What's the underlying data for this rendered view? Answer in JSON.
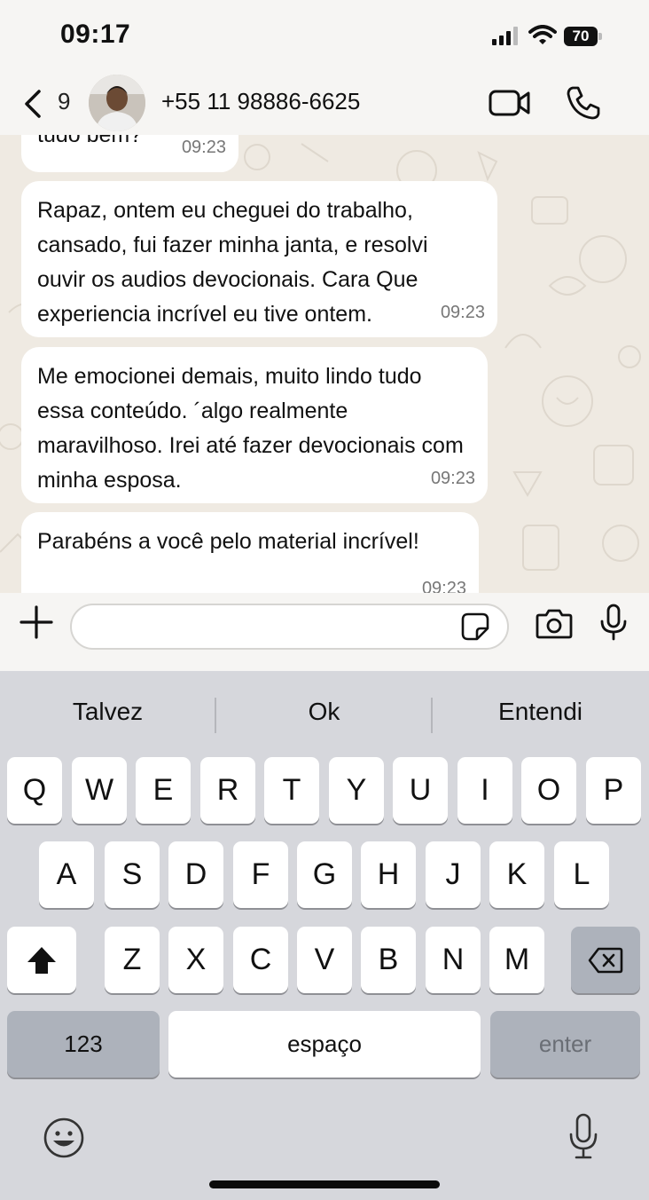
{
  "status_bar": {
    "time": "09:17",
    "battery": "70"
  },
  "header": {
    "back_count": "9",
    "contact_name": "+55 11 98886-6625"
  },
  "messages": [
    {
      "text": "tudo bem?",
      "time": "09:23"
    },
    {
      "text": "Rapaz, ontem eu cheguei do trabalho, cansado, fui fazer minha janta, e resolvi ouvir os audios devocionais. Cara Que experiencia incrível eu tive ontem.",
      "time": "09:23"
    },
    {
      "text": "Me emocionei demais, muito lindo tudo essa conteúdo. ´algo realmente maravilhoso. Irei até fazer devocionais com minha esposa.",
      "time": "09:23"
    },
    {
      "text": "Parabéns a você pelo material incrível!",
      "time": "09:23"
    }
  ],
  "input": {
    "value": "",
    "placeholder": ""
  },
  "keyboard": {
    "suggestions": [
      "Talvez",
      "Ok",
      "Entendi"
    ],
    "row1": [
      "Q",
      "W",
      "E",
      "R",
      "T",
      "Y",
      "U",
      "I",
      "O",
      "P"
    ],
    "row2": [
      "A",
      "S",
      "D",
      "F",
      "G",
      "H",
      "J",
      "K",
      "L"
    ],
    "row3": [
      "Z",
      "X",
      "C",
      "V",
      "B",
      "N",
      "M"
    ],
    "numbers_label": "123",
    "space_label": "espaço",
    "enter_label": "enter"
  },
  "colors": {
    "chat_background": "#efeae2",
    "bubble": "#ffffff",
    "keyboard_background": "#d6d7dc",
    "dark_key": "#adb2bb"
  },
  "icons": [
    "signal-icon",
    "wifi-icon",
    "battery-icon",
    "back-chevron-icon",
    "video-call-icon",
    "phone-icon",
    "plus-icon",
    "sticker-icon",
    "camera-icon",
    "microphone-icon",
    "shift-icon",
    "backspace-icon",
    "emoji-icon",
    "dictation-mic-icon"
  ]
}
